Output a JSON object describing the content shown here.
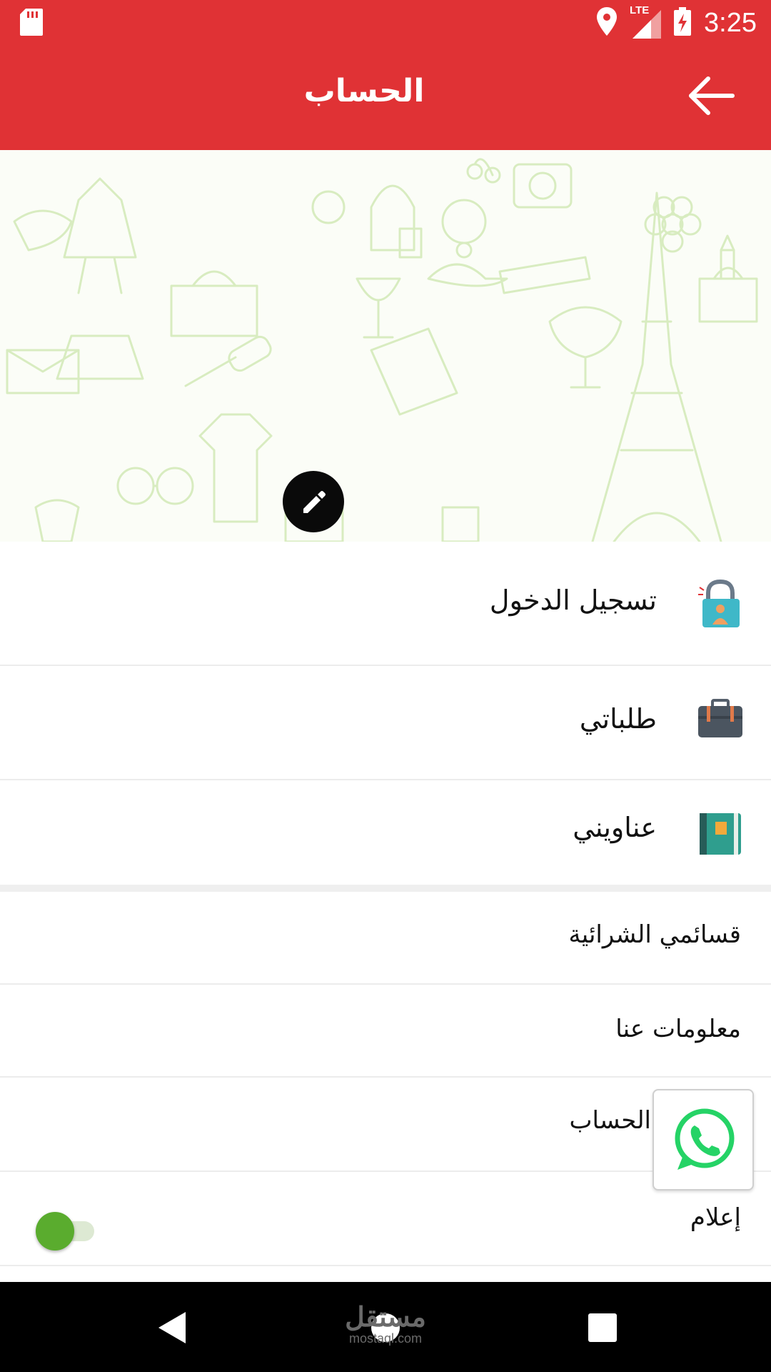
{
  "status_bar": {
    "time": "3:25",
    "network": "LTE",
    "icons": [
      "sd-card-icon",
      "location-icon",
      "signal-icon",
      "battery-charging-icon"
    ]
  },
  "app_bar": {
    "title": "الحساب",
    "back_icon": "arrow-back-icon"
  },
  "banner": {
    "edit_icon": "pencil-icon"
  },
  "menu": {
    "primary": [
      {
        "label": "تسجيل الدخول",
        "icon": "lock-user-icon"
      },
      {
        "label": "طلباتي",
        "icon": "briefcase-icon"
      },
      {
        "label": "عناويني",
        "icon": "address-book-icon"
      }
    ],
    "secondary": [
      {
        "label": "قسائمي الشرائية"
      },
      {
        "label": "معلومات عنا"
      },
      {
        "label": "الحساب"
      },
      {
        "label": "إعلام",
        "toggle": true,
        "toggle_on": true
      }
    ]
  },
  "floating": {
    "whatsapp_icon": "whatsapp-icon"
  },
  "watermark": {
    "arabic": "مستقل",
    "latin": "mostaql.com"
  },
  "colors": {
    "primary": "#e03235",
    "toggle_on": "#5aac2e",
    "whatsapp": "#25d366"
  }
}
